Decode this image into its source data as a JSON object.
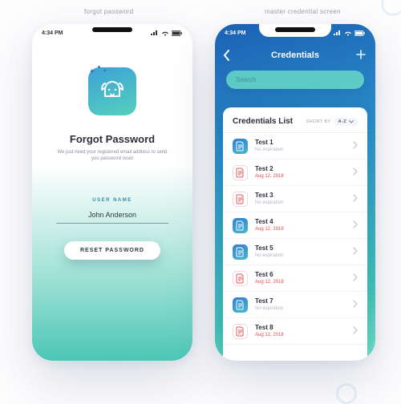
{
  "captions": {
    "left": "forgot password",
    "right": "master credential screen"
  },
  "status": {
    "time": "4:34 PM"
  },
  "forgot": {
    "title": "Forgot Password",
    "subtitle": "We just need your registered email address to send you password reset",
    "field_label": "USER NAME",
    "field_value": "John Anderson",
    "button": "RESET PASSWORD"
  },
  "credentials": {
    "header_title": "Credentials",
    "search_placeholder": "Search",
    "list_title": "Credentials List",
    "sort_label": "SHORT BY",
    "sort_value": "A-Z",
    "items": [
      {
        "title": "Test 1",
        "sub": "No expiration",
        "variant": "blue",
        "subStyle": ""
      },
      {
        "title": "Test 2",
        "sub": "Aug 12, 2018",
        "variant": "red",
        "subStyle": "red"
      },
      {
        "title": "Test 3",
        "sub": "No expiration",
        "variant": "red",
        "subStyle": ""
      },
      {
        "title": "Test 4",
        "sub": "Aug 12, 2018",
        "variant": "blue",
        "subStyle": "red"
      },
      {
        "title": "Test 5",
        "sub": "No expiration",
        "variant": "blue",
        "subStyle": ""
      },
      {
        "title": "Test 6",
        "sub": "Aug 12, 2018",
        "variant": "red",
        "subStyle": "red"
      },
      {
        "title": "Test 7",
        "sub": "No expiration",
        "variant": "blue",
        "subStyle": ""
      },
      {
        "title": "Test 8",
        "sub": "Aug 12, 2018",
        "variant": "red",
        "subStyle": "red"
      }
    ]
  }
}
